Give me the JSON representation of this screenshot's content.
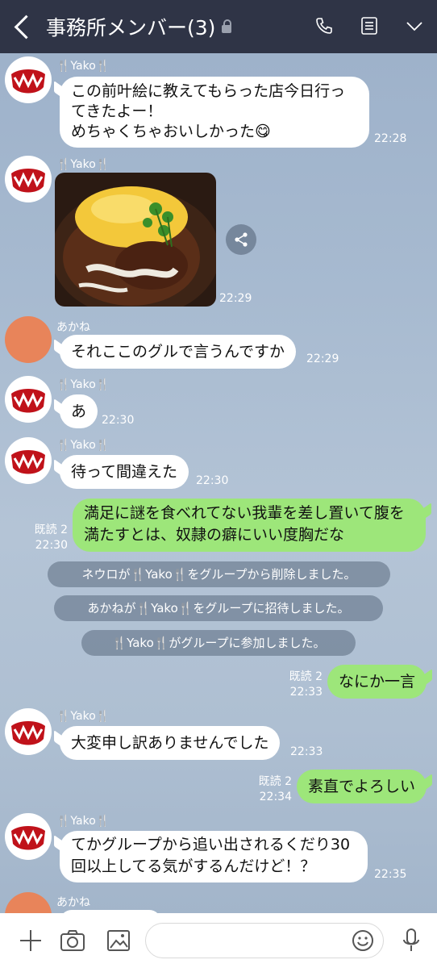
{
  "header": {
    "title": "事務所メンバー(3)"
  },
  "messages": {
    "m1": {
      "sender": "🍴Yako🍴",
      "lines": [
        "この前叶絵に教えてもらった店今日行っ",
        "てきたよー！",
        "めちゃくちゃおいしかった😋"
      ],
      "time": "22:28"
    },
    "m2": {
      "sender": "🍴Yako🍴",
      "time": "22:29"
    },
    "m3": {
      "sender": "あかね",
      "text": "それここのグルで言うんですか",
      "time": "22:29"
    },
    "m4": {
      "sender": "🍴Yako🍴",
      "text": "あ",
      "time": "22:30"
    },
    "m5": {
      "sender": "🍴Yako🍴",
      "text": "待って間違えた",
      "time": "22:30"
    },
    "m6": {
      "lines": [
        "満足に謎を食べれてない我輩を差し置いて腹を",
        "満たすとは、奴隷の癖にいい度胸だな"
      ],
      "read": "既読 2",
      "time": "22:30"
    },
    "sys1": "ネウロが🍴Yako🍴をグループから削除しました。",
    "sys2": "あかねが🍴Yako🍴をグループに招待しました。",
    "sys3": "🍴Yako🍴がグループに参加しました。",
    "m7": {
      "text": "なにか一言",
      "read": "既読 2",
      "time": "22:33"
    },
    "m8": {
      "sender": "🍴Yako🍴",
      "text": "大変申し訳ありませんでした",
      "time": "22:33"
    },
    "m9": {
      "text": "素直でよろしい",
      "read": "既読 2",
      "time": "22:34"
    },
    "m10": {
      "sender": "🍴Yako🍴",
      "lines": [
        "てかグループから追い出されるくだり30",
        "回以上してる気がするんだけど！？"
      ],
      "time": "22:35"
    },
    "m11": {
      "sender": "あかね"
    }
  },
  "colors": {
    "header": "#2f3446",
    "my_bubble": "#9de67a",
    "their_bubble": "#ffffff"
  },
  "icons": [
    "back-icon",
    "lock-icon",
    "phone-icon",
    "notes-icon",
    "chevron-down-icon",
    "share-icon",
    "plus-icon",
    "camera-icon",
    "image-icon",
    "emoji-icon",
    "mic-icon"
  ]
}
